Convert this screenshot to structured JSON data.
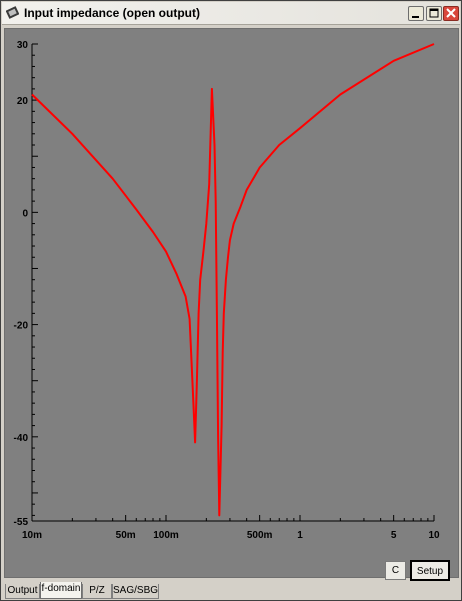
{
  "window": {
    "title": "Input impedance (open output)"
  },
  "toolbar_icons": {
    "minimize": "minimize-icon",
    "maximize": "maximize-icon",
    "close": "close-icon"
  },
  "buttons": {
    "c_label": "C",
    "setup_label": "Setup"
  },
  "tabs": [
    {
      "label": "Output",
      "active": false
    },
    {
      "label": "f-domain",
      "active": true
    },
    {
      "label": "P/Z",
      "active": false
    },
    {
      "label": "SAG/SBG",
      "active": false
    }
  ],
  "colors": {
    "plot_background": "#808080",
    "trace": "#ff0000",
    "axis": "#000000"
  },
  "chart_data": {
    "type": "line",
    "title": "",
    "xlabel": "",
    "ylabel": "",
    "x_scale": "log",
    "xlim": [
      0.01,
      10
    ],
    "ylim": [
      -55,
      30
    ],
    "x_tick_labels": [
      {
        "value": 0.01,
        "label": "10m"
      },
      {
        "value": 0.05,
        "label": "50m"
      },
      {
        "value": 0.1,
        "label": "100m"
      },
      {
        "value": 0.5,
        "label": "500m"
      },
      {
        "value": 1,
        "label": "1"
      },
      {
        "value": 5,
        "label": "5"
      },
      {
        "value": 10,
        "label": "10"
      }
    ],
    "y_tick_labels": [
      {
        "value": 30,
        "label": "30"
      },
      {
        "value": 20,
        "label": "20"
      },
      {
        "value": 0,
        "label": "0"
      },
      {
        "value": -20,
        "label": "-20"
      },
      {
        "value": -40,
        "label": "-40"
      },
      {
        "value": -55,
        "label": "-55"
      }
    ],
    "grid": false,
    "series": [
      {
        "color": "#ff0000",
        "x": [
          0.01,
          0.02,
          0.04,
          0.06,
          0.08,
          0.1,
          0.12,
          0.14,
          0.15,
          0.16,
          0.165,
          0.17,
          0.175,
          0.18,
          0.19,
          0.2,
          0.21,
          0.22,
          0.23,
          0.235,
          0.24,
          0.245,
          0.25,
          0.26,
          0.265,
          0.27,
          0.28,
          0.29,
          0.3,
          0.32,
          0.36,
          0.4,
          0.5,
          0.7,
          1,
          2,
          5,
          10
        ],
        "y": [
          21,
          14,
          6,
          0.5,
          -3.5,
          -7,
          -11,
          -15,
          -19,
          -34,
          -41,
          -30,
          -18,
          -12,
          -7,
          -2,
          5,
          22,
          12,
          2,
          -18,
          -40,
          -54,
          -38,
          -25,
          -18,
          -12,
          -8,
          -5,
          -2,
          1,
          4,
          8,
          12,
          15,
          21,
          27,
          30
        ]
      }
    ]
  }
}
